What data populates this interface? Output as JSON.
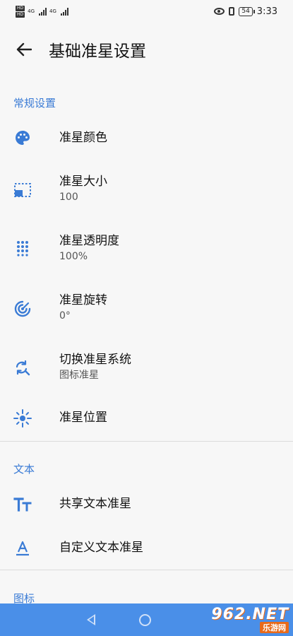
{
  "status_bar": {
    "network_left": "HD",
    "network_left2": "HD",
    "sig1_label": "4G",
    "sig2_label": "4G",
    "battery": "54",
    "time": "3:33"
  },
  "app_bar": {
    "title": "基础准星设置"
  },
  "sections": {
    "general": "常规设置",
    "text": "文本",
    "icon": "图标"
  },
  "items": [
    {
      "title": "准星颜色",
      "subtitle": ""
    },
    {
      "title": "准星大小",
      "subtitle": "100"
    },
    {
      "title": "准星透明度",
      "subtitle": "100%"
    },
    {
      "title": "准星旋转",
      "subtitle": "0°"
    },
    {
      "title": "切换准星系统",
      "subtitle": "图标准星"
    },
    {
      "title": "准星位置",
      "subtitle": ""
    },
    {
      "title": "共享文本准星",
      "subtitle": ""
    },
    {
      "title": "自定义文本准星",
      "subtitle": ""
    }
  ],
  "watermark": {
    "top": "962.NET",
    "bottom": "乐游网"
  },
  "colors": {
    "accent": "#3a7bd5",
    "navbar": "#4a8fe8",
    "background": "#f7f7f7"
  }
}
